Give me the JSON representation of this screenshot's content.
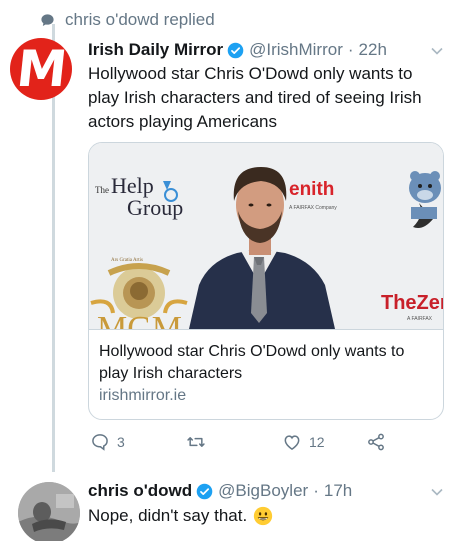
{
  "context": {
    "replied_text": "chris o'dowd replied"
  },
  "tweet1": {
    "avatar_letter": "M",
    "name": "Irish Daily Mirror",
    "handle": "@IrishMirror",
    "separator": "·",
    "time": "22h",
    "text": "Hollywood star Chris O'Dowd only wants to play Irish characters and tired of seeing Irish actors playing Americans",
    "card": {
      "title": "Hollywood star Chris O'Dowd only wants to play Irish characters",
      "domain": "irishmirror.ie",
      "image_logos": {
        "helpgroup_small": "The",
        "helpgroup_big": "Help",
        "helpgroup_group": "Group",
        "zenith": "enith",
        "zenith_sub": "A FAIRFAX Company",
        "thezen": "TheZen",
        "thezen_sub": "A FAIRFAX",
        "mgm": "MGM",
        "mgm_ribbon": "Ars Gratia Artis"
      }
    },
    "actions": {
      "reply_count": "3",
      "retweet_count": "",
      "like_count": "12"
    }
  },
  "tweet2": {
    "name": "chris o'dowd",
    "handle": "@BigBoyler",
    "separator": "·",
    "time": "17h",
    "text": "Nope, didn't say that."
  },
  "colors": {
    "verified_blue": "#1da1f2",
    "mirror_red": "#e2231a",
    "secondary": "#657786",
    "thread_line": "#cfd9de"
  }
}
